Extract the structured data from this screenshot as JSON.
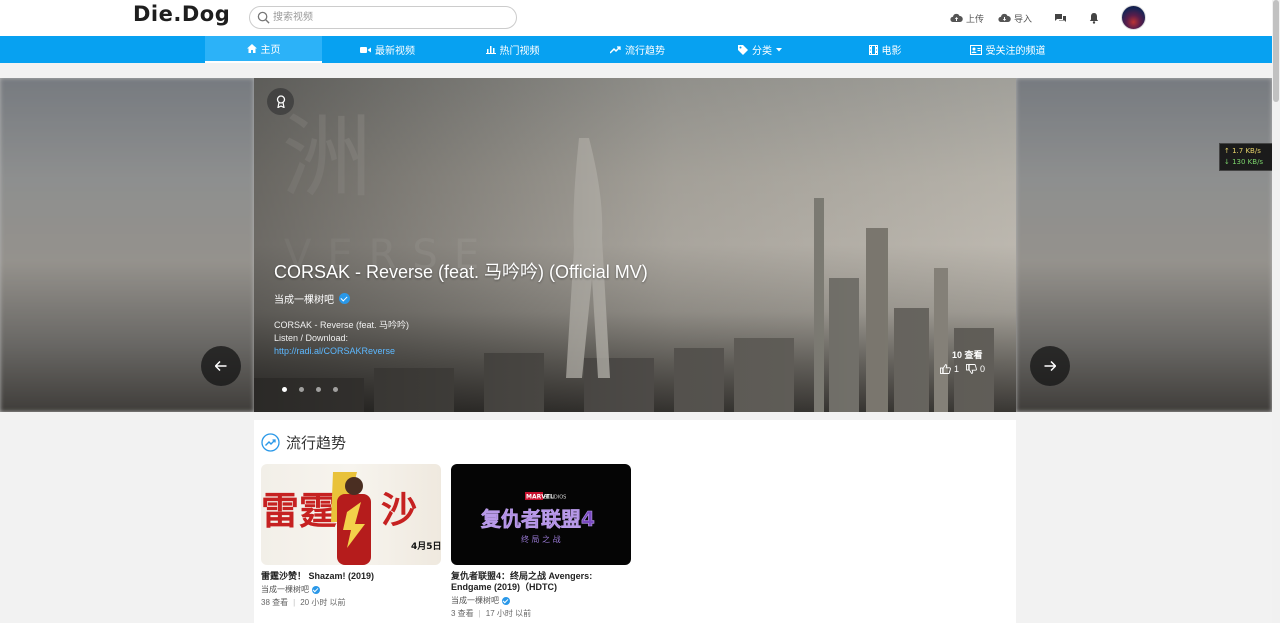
{
  "header": {
    "logo": "Die.Dog",
    "search_placeholder": "搜索视频",
    "upload_label": "上传",
    "import_label": "导入"
  },
  "nav": {
    "items": [
      {
        "label": "主页",
        "icon": "home-icon"
      },
      {
        "label": "最新视频",
        "icon": "video-camera-icon"
      },
      {
        "label": "热门视频",
        "icon": "bar-chart-icon"
      },
      {
        "label": "流行趋势",
        "icon": "trending-icon"
      },
      {
        "label": "分类",
        "icon": "tag-icon"
      },
      {
        "label": "电影",
        "icon": "film-icon"
      },
      {
        "label": "受关注的频道",
        "icon": "channel-icon"
      }
    ]
  },
  "carousel": {
    "title": "CORSAK - Reverse (feat. 马吟吟) (Official MV)",
    "channel": "当成一棵树吧",
    "description_line1": "CORSAK - Reverse (feat. 马吟吟)",
    "description_line2": "Listen / Download:",
    "link": "http://radi.al/CORSAKReverse",
    "views": "10 查看",
    "likes": "1",
    "dislikes": "0",
    "slide_count": 4,
    "active_slide": 1
  },
  "speed": {
    "up": "↑ 1.7 KB/s",
    "down": "↓ 130 KB/s"
  },
  "trending": {
    "title": "流行趋势",
    "videos": [
      {
        "title": "雷霆沙赞！ Shazam! (2019)",
        "channel": "当成一棵树吧",
        "views": "38 查看",
        "time": "20 小时 以前"
      },
      {
        "title": "复仇者联盟4：终局之战 Avengers: Endgame (2019)（HDTC)",
        "channel": "当成一棵树吧",
        "views": "3 查看",
        "time": "17 小时 以前"
      }
    ]
  },
  "colors": {
    "nav_bg": "#07a1f1",
    "accent": "#2a98e8"
  }
}
